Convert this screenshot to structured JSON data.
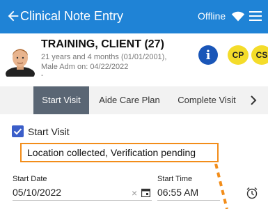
{
  "header": {
    "title": "Clinical Note Entry",
    "status": "Offline",
    "icons": [
      "back-arrow-icon",
      "wifi-icon",
      "menu-icon"
    ],
    "background": "#1f83d6"
  },
  "client": {
    "name": "TRAINING, CLIENT (27)",
    "age_line": "21 years and 4 months (01/01/2001),",
    "adm_line": "Male Adm on: 04/22/2022",
    "extra_line": "-",
    "badges": {
      "info": "i",
      "cp": "CP",
      "cs": "CS"
    }
  },
  "tabs": [
    {
      "label": "Start Visit",
      "active": true
    },
    {
      "label": "Aide Care Plan",
      "active": false
    },
    {
      "label": "Complete Visit",
      "active": false
    }
  ],
  "start_visit": {
    "checkbox_label": "Start Visit",
    "checked": true,
    "status_message": "Location collected, Verification pending",
    "highlight_color": "#f28d1a"
  },
  "fields": {
    "start_date_label": "Start Date",
    "start_date_value": "05/10/2022",
    "start_time_label": "Start Time",
    "start_time_value": "06:55 AM"
  }
}
